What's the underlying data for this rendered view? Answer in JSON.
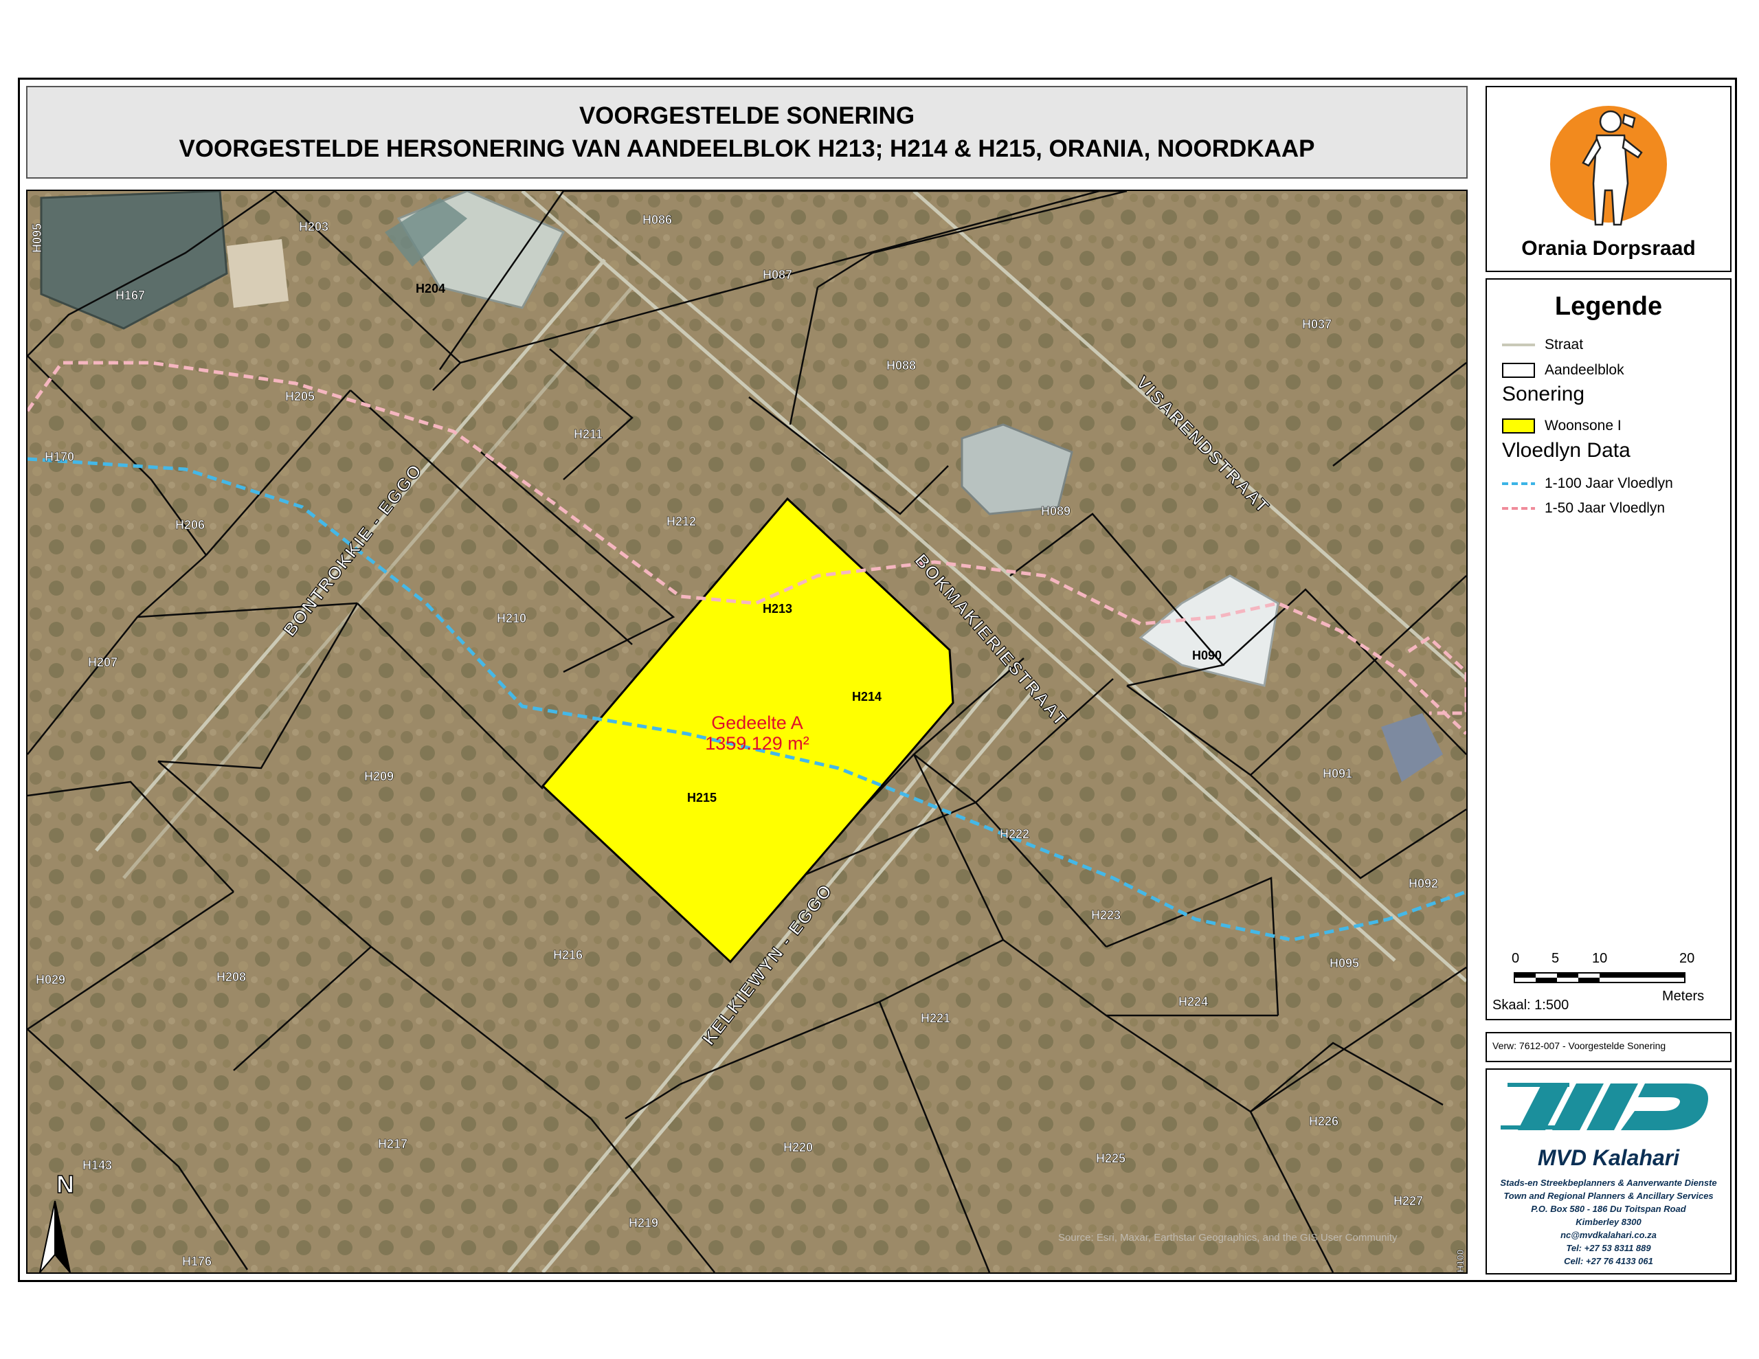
{
  "title": {
    "line1": "VOORGESTELDE SONERING",
    "line2": "VOORGESTELDE HERSONERING VAN AANDEELBLOK H213; H214 & H215, ORANIA, NOORDKAAP"
  },
  "map": {
    "parcel_labels": [
      "H203",
      "H095",
      "H167",
      "H204",
      "H086",
      "H087",
      "H088",
      "H037",
      "H205",
      "H170",
      "H211",
      "H206",
      "H212",
      "H089",
      "H213",
      "H210",
      "H090",
      "H207",
      "H214",
      "H209",
      "H215",
      "H091",
      "H222",
      "H092",
      "H223",
      "H029",
      "H208",
      "H216",
      "H095",
      "H224",
      "H221",
      "H217",
      "H226",
      "H143",
      "H220",
      "H225",
      "H227",
      "H219",
      "H176",
      "H100"
    ],
    "street_labels": {
      "bontrokkie": "BONTROKKIE - EGGO",
      "bokmakierie": "BOKMAKIERIESTRAAT",
      "visarend": "VISARENDSTRAAT",
      "kelkiewyn": "KELKIEWYN - EGGO"
    },
    "area_name": "Gedeelte A",
    "area_value": "1359.129 m²",
    "north_label": "N",
    "attribution": "Source: Esri, Maxar, Earthstar Geographics, and the GIS User Community"
  },
  "logo": {
    "caption": "Orania Dorpsraad",
    "icon": "orania-figure-icon"
  },
  "legend": {
    "title": "Legende",
    "street": "Straat",
    "block": "Aandeelblok",
    "zoning_header": "Sonering",
    "zone": "Woonsone I",
    "flood_header": "Vloedlyn Data",
    "flood_100": "1-100 Jaar Vloedlyn",
    "flood_50": "1-50 Jaar Vloedlyn"
  },
  "scale": {
    "ticks": [
      "0",
      "5",
      "10",
      "20"
    ],
    "unit": "Meters",
    "ratio": "Skaal: 1:500"
  },
  "reference": "Verw: 7612-007 - Voorgestelde Sonering",
  "company": {
    "name": "MVD Kalahari",
    "lines": [
      "Stads-en Streekbeplanners & Aanverwante Dienste",
      "Town and Regional Planners & Ancillary Services",
      "P.O. Box 580 - 186 Du Toitspan Road",
      "Kimberley 8300",
      "nc@mvdkalahari.co.za",
      "Tel:  +27 53 8311 889",
      "Cell: +27 76 4133 061"
    ]
  },
  "colors": {
    "zone_fill": "#ffff00",
    "flood_100": "#3cb4e6",
    "flood_50": "#f08c9b",
    "street": "#c9c9b8",
    "area_label": "#e0102a",
    "logo_circle": "#f28a1e",
    "company": "#1b8f9c"
  }
}
